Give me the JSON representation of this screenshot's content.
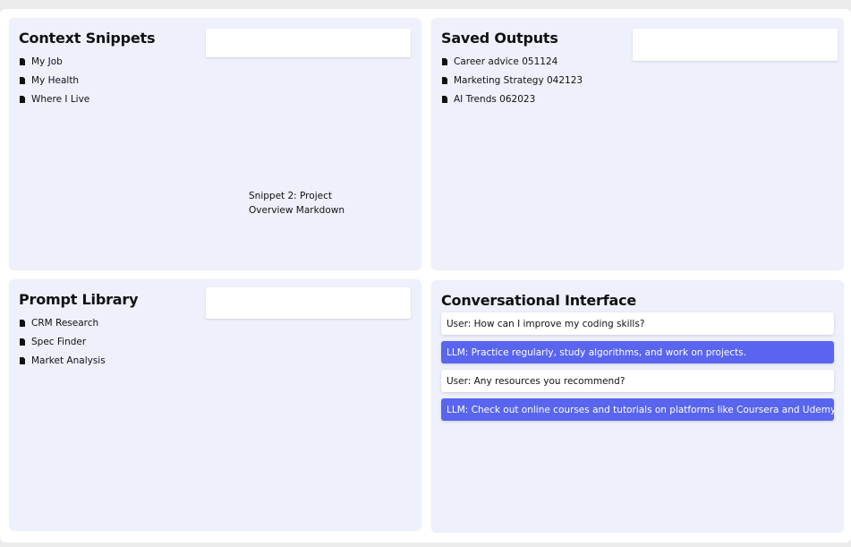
{
  "colors": {
    "page_bg": "#ebebeb",
    "panel_bg": "#eef0fc",
    "llm_bubble": "#5965ee",
    "user_bubble": "#ffffff"
  },
  "context_snippets": {
    "title": "Context Snippets",
    "icon": "file-icon",
    "items": [
      {
        "label": "My Job"
      },
      {
        "label": "My Health"
      },
      {
        "label": "Where I Live"
      }
    ],
    "preview_text": "",
    "dragging_label": "Snippet 2: Project Overview Markdown"
  },
  "saved_outputs": {
    "title": "Saved Outputs",
    "icon": "file-icon",
    "items": [
      {
        "label": "Career advice 051124"
      },
      {
        "label": "Marketing Strategy 042123"
      },
      {
        "label": "AI Trends 062023"
      }
    ],
    "preview_text": ""
  },
  "prompt_library": {
    "title": "Prompt Library",
    "icon": "file-icon",
    "items": [
      {
        "label": "CRM Research"
      },
      {
        "label": "Spec Finder"
      },
      {
        "label": "Market Analysis"
      }
    ],
    "preview_text": ""
  },
  "conversation": {
    "title": "Conversational Interface",
    "messages": [
      {
        "role": "user",
        "text": "User: How can I improve my coding skills?"
      },
      {
        "role": "llm",
        "text": "LLM: Practice regularly, study algorithms, and work on projects."
      },
      {
        "role": "user",
        "text": "User: Any resources you recommend?"
      },
      {
        "role": "llm",
        "text": "LLM: Check out online courses and tutorials on platforms like Coursera and Udemy."
      }
    ]
  }
}
